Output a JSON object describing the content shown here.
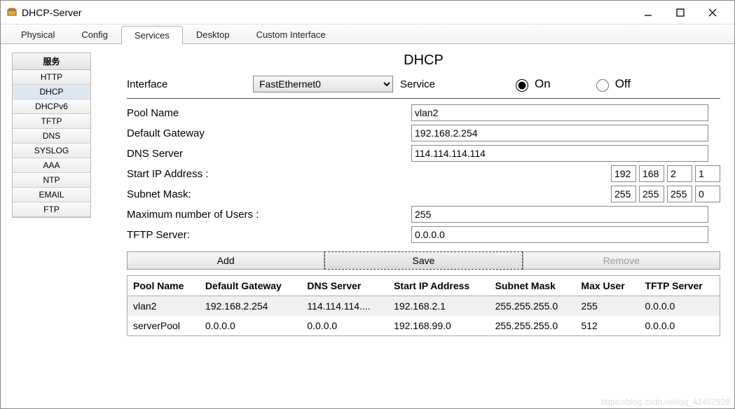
{
  "window": {
    "title": "DHCP-Server"
  },
  "tabs": [
    "Physical",
    "Config",
    "Services",
    "Desktop",
    "Custom Interface"
  ],
  "active_tab_index": 2,
  "sidebar": {
    "header": "服务",
    "items": [
      "HTTP",
      "DHCP",
      "DHCPv6",
      "TFTP",
      "DNS",
      "SYSLOG",
      "AAA",
      "NTP",
      "EMAIL",
      "FTP"
    ],
    "active": "DHCP"
  },
  "main": {
    "heading": "DHCP",
    "interface_label": "Interface",
    "interface_selected": "FastEthernet0",
    "service_label": "Service",
    "on_label": "On",
    "off_label": "Off",
    "service_on": true,
    "pool_name_label": "Pool Name",
    "pool_name": "vlan2",
    "default_gateway_label": "Default Gateway",
    "default_gateway": "192.168.2.254",
    "dns_server_label": "DNS Server",
    "dns_server": "114.114.114.114",
    "start_ip_label": "Start IP Address :",
    "start_ip": [
      "192",
      "168",
      "2",
      "1"
    ],
    "subnet_label": "Subnet Mask:",
    "subnet": [
      "255",
      "255",
      "255",
      "0"
    ],
    "max_users_label": "Maximum number of Users :",
    "max_users": "255",
    "tftp_label": "TFTP Server:",
    "tftp": "0.0.0.0",
    "buttons": {
      "add": "Add",
      "save": "Save",
      "remove": "Remove"
    }
  },
  "table": {
    "headers": [
      "Pool Name",
      "Default Gateway",
      "DNS Server",
      "Start IP Address",
      "Subnet Mask",
      "Max User",
      "TFTP Server"
    ],
    "rows": [
      {
        "cells": [
          "vlan2",
          "192.168.2.254",
          "114.114.114....",
          "192.168.2.1",
          "255.255.255.0",
          "255",
          "0.0.0.0"
        ],
        "selected": true
      },
      {
        "cells": [
          "serverPool",
          "0.0.0.0",
          "0.0.0.0",
          "192.168.99.0",
          "255.255.255.0",
          "512",
          "0.0.0.0"
        ],
        "selected": false
      }
    ]
  },
  "watermark": "https://blog.csdn.net/qq_42452928"
}
